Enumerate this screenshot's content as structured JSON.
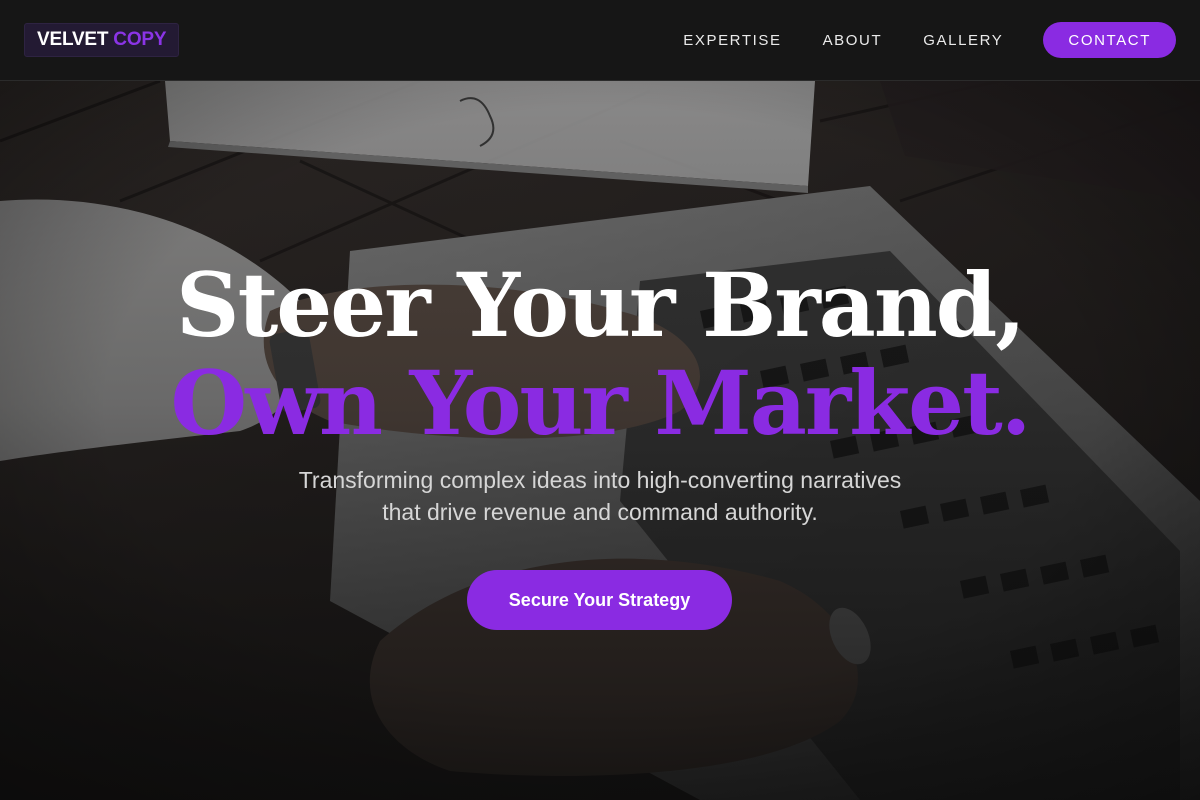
{
  "brand": {
    "name_part1": "VELVET",
    "name_part2": "COPY"
  },
  "nav": {
    "items": [
      {
        "label": "EXPERTISE"
      },
      {
        "label": "ABOUT"
      },
      {
        "label": "GALLERY"
      }
    ],
    "contact_label": "CONTACT"
  },
  "hero": {
    "headline_line1": "Steer Your Brand,",
    "headline_line2": "Own Your Market.",
    "subtitle_line1": "Transforming complex ideas into high-converting narratives",
    "subtitle_line2": "that drive revenue and command authority.",
    "cta_label": "Secure Your Strategy",
    "background_image": "hands-typing-on-laptop-photo"
  },
  "colors": {
    "accent": "#8a2be2",
    "nav_background": "#161616",
    "page_background": "#141414"
  }
}
